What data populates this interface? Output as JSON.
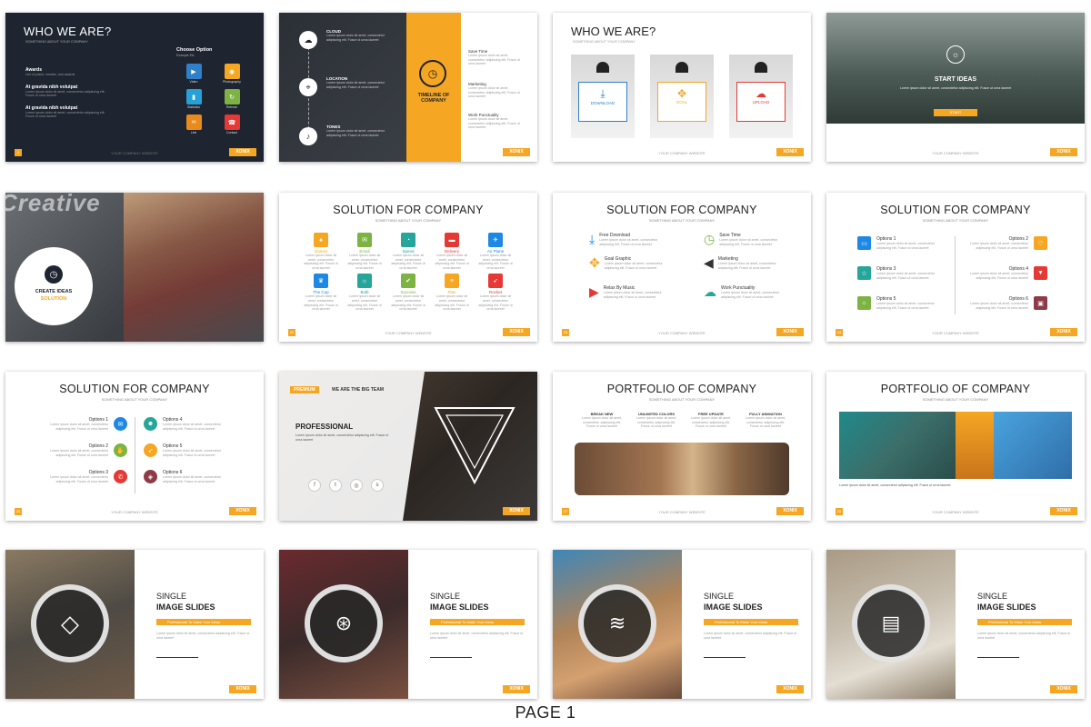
{
  "page_label": "PAGE 1",
  "watermark": "Creative",
  "brand_tag": "XONIX",
  "website": "YOUR COMPANY WEBSITE",
  "lorem": "Lorem ipsum dolor sit amet, consectetur adipiscing elit. Fusce ut urna laoreet",
  "s1": {
    "title": "WHO WE ARE?",
    "sub": "SOMETHING ABOUT YOUR COMPANY",
    "items": [
      "Awards",
      "At gravida nibh volutpat",
      "At gravida nibh volutpat"
    ],
    "item_desc": "List of prizes, medals, and awards",
    "choose": "Choose Option",
    "choose_sub": "Example Etc",
    "icons": [
      {
        "label": "Video",
        "color": "#2f80c9",
        "icon": "play-icon",
        "glyph": "▶"
      },
      {
        "label": "Photography",
        "color": "#f5a623",
        "icon": "camera-icon",
        "glyph": "◉"
      },
      {
        "label": "Statistics",
        "color": "#27a0d8",
        "icon": "chart-icon",
        "glyph": "▮"
      },
      {
        "label": "Refresh",
        "color": "#7cb342",
        "icon": "refresh-icon",
        "glyph": "↻"
      },
      {
        "label": "Link",
        "color": "#e88b1c",
        "icon": "link-icon",
        "glyph": "∞"
      },
      {
        "label": "Contact",
        "color": "#e53935",
        "icon": "contact-icon",
        "glyph": "☎"
      }
    ]
  },
  "s2": {
    "rows": [
      "CLOUD",
      "LOCATION",
      "TONES"
    ],
    "timeline": "TIMELINE OF COMPANY",
    "right": [
      "Save Time",
      "Marketing",
      "Work Punctuality"
    ]
  },
  "s3": {
    "title": "WHO WE ARE?",
    "sub": "SOMETHING ABOUT YOUR COMPANY",
    "cards": [
      "DOWNLOAD",
      "GOAL",
      "UPLOAD"
    ]
  },
  "s4": {
    "title": "START IDEAS",
    "button": "START"
  },
  "s5": {
    "line1": "CREATE IDEAS",
    "line2": "SOLUTION"
  },
  "s6": {
    "title": "SOLUTION FOR COMPANY",
    "sub": "SOMETHING ABOUT YOUR COMPANY",
    "items": [
      {
        "label": "Games",
        "color": "#f5a623"
      },
      {
        "label": "Email",
        "color": "#7cb342"
      },
      {
        "label": "Speed",
        "color": "#26a69a"
      },
      {
        "label": "Delivery",
        "color": "#e53935"
      },
      {
        "label": "Air Plane",
        "color": "#1e88e5"
      },
      {
        "label": "The Cup",
        "color": "#1e88e5"
      },
      {
        "label": "Bulb",
        "color": "#26a69a"
      },
      {
        "label": "Success",
        "color": "#7cb342"
      },
      {
        "label": "Plan",
        "color": "#f5a623"
      },
      {
        "label": "Rocket",
        "color": "#e53935"
      }
    ]
  },
  "s7": {
    "title": "SOLUTION FOR COMPANY",
    "sub": "SOMETHING ABOUT YOUR COMPANY",
    "left": [
      "Free Download",
      "Goal Graphic",
      "Relax By Music"
    ],
    "right": [
      "Save Time",
      "Marketing",
      "Work Punctuality"
    ]
  },
  "s8": {
    "title": "SOLUTION FOR COMPANY",
    "sub": "SOMETHING ABOUT YOUR COMPANY",
    "left": [
      "Options 1",
      "Options 3",
      "Options 5"
    ],
    "right": [
      "Options 2",
      "Options 4",
      "Options 6"
    ]
  },
  "s9": {
    "title": "SOLUTION FOR COMPANY",
    "sub": "SOMETHING ABOUT YOUR COMPANY",
    "left": [
      "Options 1",
      "Options 2",
      "Options 3"
    ],
    "right": [
      "Options 4",
      "Options 5",
      "Options 6"
    ]
  },
  "s10": {
    "tag": "PREMIUM",
    "team": "WE ARE THE BIG TEAM",
    "heading": "PROFESSIONAL"
  },
  "s11": {
    "title": "PORTFOLIO OF COMPANY",
    "sub": "SOMETHING ABOUT YOUR COMPANY",
    "cols": [
      "BREAK NEW",
      "UNLIMITED COLORS",
      "FREE UPDATE",
      "FULLY ANIMATION"
    ]
  },
  "s12": {
    "title": "PORTFOLIO OF COMPANY",
    "sub": "SOMETHING ABOUT YOUR COMPANY"
  },
  "single": {
    "line1": "SINGLE",
    "line2": "IMAGE SLIDES",
    "tag": "Professional To Make Your Ideas"
  }
}
